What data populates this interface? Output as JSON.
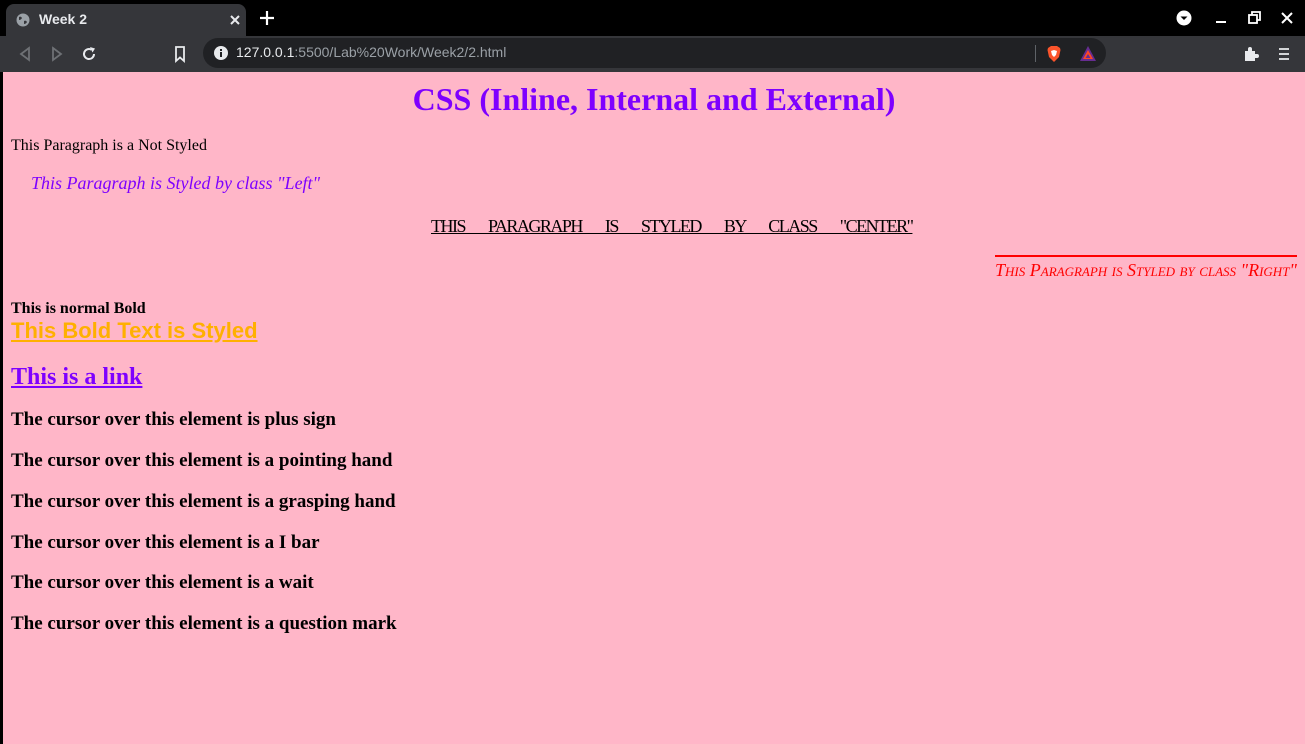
{
  "browser": {
    "tab_title": "Week 2",
    "url_host": "127.0.0.1",
    "url_path": ":5500/Lab%20Work/Week2/2.html"
  },
  "page": {
    "heading": "CSS (Inline, Internal and External)",
    "p_not_styled": "This Paragraph is a Not Styled",
    "p_left": "This Paragraph is Styled by class \"Left\"",
    "p_center": "This Paragraph is Styled by class \"Center\"",
    "p_right": "This Paragraph is Styled by class \"Right\"",
    "bold_normal": "This is normal Bold",
    "bold_styled": "This Bold Text is Styled",
    "link_text": "This is a link",
    "cursor_items": [
      "The cursor over this element is plus sign",
      "The cursor over this element is a pointing hand",
      "The cursor over this element is a grasping hand",
      "The cursor over this element is a I bar",
      "The cursor over this element is a wait",
      "The cursor over this element is a question mark"
    ]
  },
  "colors": {
    "page_background": "#ffb6c8",
    "heading": "#7e00ff",
    "right_paragraph": "#ff0000",
    "styled_bold": "#ffb000"
  }
}
